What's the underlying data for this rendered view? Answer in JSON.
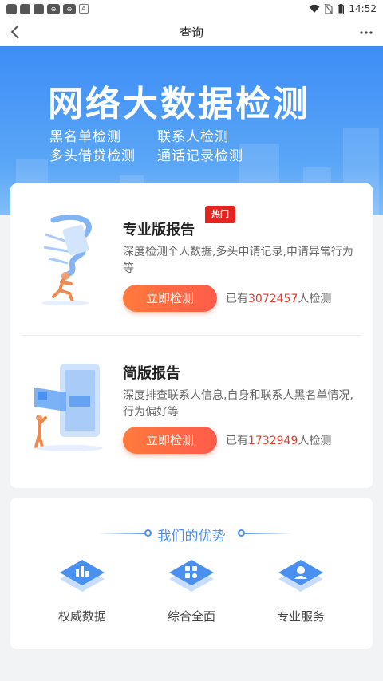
{
  "status_bar": {
    "time": "14:52"
  },
  "nav": {
    "back_icon": "chevron-left-icon",
    "title": "查询",
    "more_icon": "more-dots-icon"
  },
  "banner": {
    "title": "网络大数据检测",
    "features": [
      "黑名单检测",
      "联系人检测",
      "多头借贷检测",
      "通话记录检测"
    ]
  },
  "reports": [
    {
      "title": "专业版报告",
      "badge": "热门",
      "description": "深度检测个人数据,多头申请记录,申请异常行为等",
      "button": "立即检测",
      "count_prefix": "已有",
      "count_value": "3072457",
      "count_suffix": "人检测"
    },
    {
      "title": "简版报告",
      "description": "深度排查联系人信息,自身和联系人黑名单情况,行为偏好等",
      "button": "立即检测",
      "count_prefix": "已有",
      "count_value": "1732949",
      "count_suffix": "人检测"
    }
  ],
  "advantages": {
    "title": "我们的优势",
    "items": [
      {
        "label": "权威数据",
        "icon": "bar-chart-icon"
      },
      {
        "label": "综合全面",
        "icon": "grid-icon"
      },
      {
        "label": "专业服务",
        "icon": "support-agent-icon"
      }
    ]
  },
  "colors": {
    "primary": "#3d8df5",
    "accent": "#ff6a45",
    "count_highlight": "#e43b2c",
    "badge": "#e5231f"
  }
}
